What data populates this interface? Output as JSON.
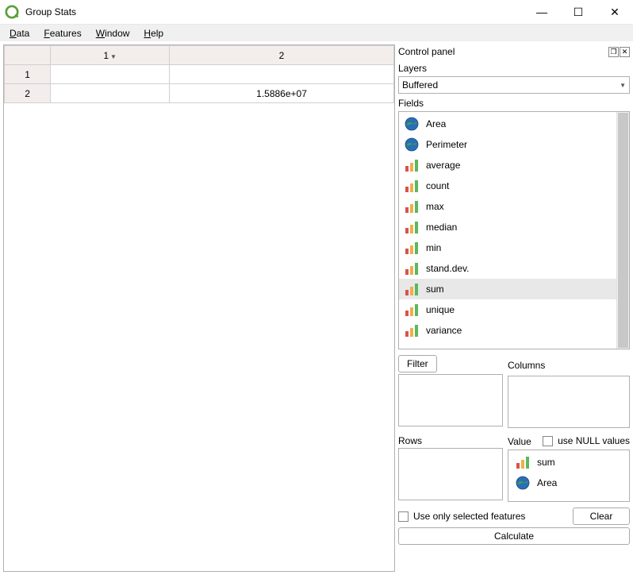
{
  "window": {
    "title": "Group Stats",
    "minimize": "—",
    "maximize": "☐",
    "close": "✕"
  },
  "menubar": {
    "data": "Data",
    "features": "Features",
    "window": "Window",
    "help": "Help"
  },
  "table": {
    "col_headers": [
      "1",
      "2"
    ],
    "row_headers": [
      "1",
      "2"
    ],
    "rows": [
      [
        "",
        ""
      ],
      [
        "",
        "1.5886e+07"
      ]
    ]
  },
  "panel": {
    "title": "Control panel",
    "layers_label": "Layers",
    "layers_value": "Buffered",
    "fields_label": "Fields",
    "fields": [
      {
        "label": "Area",
        "icon": "globe"
      },
      {
        "label": "Perimeter",
        "icon": "globe"
      },
      {
        "label": "average",
        "icon": "bars"
      },
      {
        "label": "count",
        "icon": "bars"
      },
      {
        "label": "max",
        "icon": "bars"
      },
      {
        "label": "median",
        "icon": "bars"
      },
      {
        "label": "min",
        "icon": "bars"
      },
      {
        "label": "stand.dev.",
        "icon": "bars"
      },
      {
        "label": "sum",
        "icon": "bars",
        "selected": true
      },
      {
        "label": "unique",
        "icon": "bars"
      },
      {
        "label": "variance",
        "icon": "bars"
      }
    ],
    "filter_btn": "Filter",
    "columns_label": "Columns",
    "rows_label": "Rows",
    "value_label": "Value",
    "use_null_label": "use NULL values",
    "value_items": [
      {
        "label": "sum",
        "icon": "bars"
      },
      {
        "label": "Area",
        "icon": "globe"
      }
    ],
    "use_selected_label": "Use only selected features",
    "clear_btn": "Clear",
    "calculate_btn": "Calculate"
  }
}
